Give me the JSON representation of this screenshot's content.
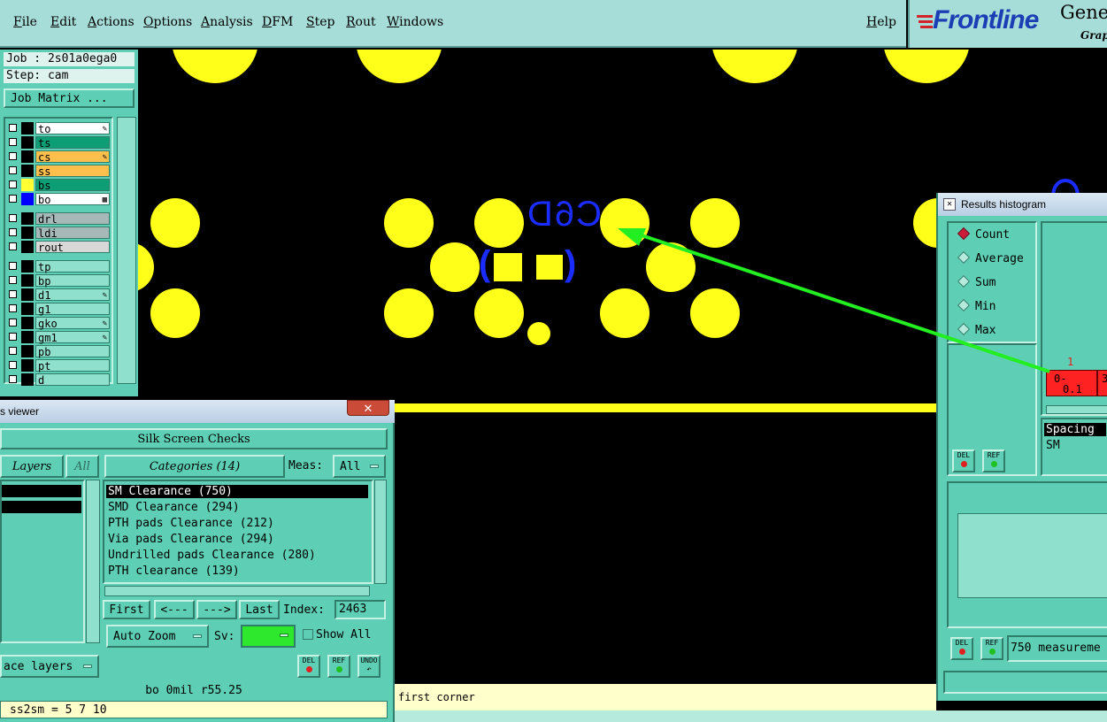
{
  "menubar": {
    "items": [
      "File",
      "Edit",
      "Actions",
      "Options",
      "Analysis",
      "DFM",
      "Step",
      "Rout",
      "Windows"
    ],
    "help": "Help"
  },
  "logo": {
    "brand": "Frontline",
    "word1": "Gene",
    "word2": "Graph"
  },
  "job": {
    "job_line": "Job : 2s01a0ega0",
    "step_line": "Step: cam",
    "matrix_button": "Job Matrix ..."
  },
  "layers": [
    {
      "name": "to",
      "color": "#ffffff",
      "swatch": "#000000",
      "mark": "✎"
    },
    {
      "name": "ts",
      "color": "#0e9e75",
      "swatch": "#000000",
      "mark": ""
    },
    {
      "name": "cs",
      "color": "#ffbf4d",
      "swatch": "#000000",
      "mark": "✎"
    },
    {
      "name": "ss",
      "color": "#ffbf4d",
      "swatch": "#000000",
      "mark": ""
    },
    {
      "name": "bs",
      "color": "#0e9e75",
      "swatch": "#ffff33",
      "mark": ""
    },
    {
      "name": "bo",
      "color": "#ffffff",
      "swatch": "#0000ff",
      "mark": "▦"
    },
    {
      "name": "drl",
      "color": "#a6b8b8",
      "swatch": "#000000",
      "mark": ""
    },
    {
      "name": "ldi",
      "color": "#a6b8b8",
      "swatch": "#000000",
      "mark": ""
    },
    {
      "name": "rout",
      "color": "#d8d8d8",
      "swatch": "#000000",
      "mark": ""
    },
    {
      "name": "tp",
      "color": "#8fe0cc",
      "swatch": "#000000",
      "mark": ""
    },
    {
      "name": "bp",
      "color": "#8fe0cc",
      "swatch": "#000000",
      "mark": ""
    },
    {
      "name": "d1",
      "color": "#8fe0cc",
      "swatch": "#000000",
      "mark": "✎"
    },
    {
      "name": "g1",
      "color": "#8fe0cc",
      "swatch": "#000000",
      "mark": ""
    },
    {
      "name": "gko",
      "color": "#8fe0cc",
      "swatch": "#000000",
      "mark": "✎"
    },
    {
      "name": "gm1",
      "color": "#8fe0cc",
      "swatch": "#000000",
      "mark": "✎"
    },
    {
      "name": "pb",
      "color": "#8fe0cc",
      "swatch": "#000000",
      "mark": ""
    },
    {
      "name": "pt",
      "color": "#8fe0cc",
      "swatch": "#000000",
      "mark": ""
    },
    {
      "name": "d",
      "color": "#8fe0cc",
      "swatch": "#000000",
      "mark": ""
    }
  ],
  "canvas": {
    "silk_label": "C6D",
    "silk_left": "(",
    "silk_right": ")"
  },
  "viewer": {
    "title": "s viewer",
    "section": "Silk Screen Checks",
    "layers_label": "Layers",
    "all_label": "All",
    "categories_label": "Categories (14)",
    "meas_label": "Meas:",
    "meas_value": "All",
    "categories": [
      "SM Clearance (750)",
      "SMD Clearance (294)",
      "PTH pads Clearance (212)",
      "Via pads Clearance (294)",
      "Undrilled pads Clearance (280)",
      "PTH clearance (139)"
    ],
    "first": "First",
    "prev": "<---",
    "next": "--->",
    "last": "Last",
    "index_label": "Index:",
    "index_value": "2463",
    "auto_zoom": "Auto Zoom",
    "sv_label": "Sv:",
    "show_all": "Show All",
    "surface_layers": "ace layers",
    "del": "DEL",
    "ref": "REF",
    "undo": "UNDO",
    "info_line": "bo 0mil  r55.25",
    "cmd_line": "ss2sm = 5 7 10"
  },
  "status": {
    "text": "first corner"
  },
  "histogram": {
    "title": "Results histogram",
    "modes": [
      "Count",
      "Average",
      "Sum",
      "Min",
      "Max"
    ],
    "selected": "Count",
    "bar_count": "1",
    "bar_label_1": "0-",
    "bar_label_2": "0.1",
    "bar_next": "3",
    "list_selected": "Spacing",
    "list_item": "SM",
    "measurements": "750 measureme",
    "del": "DEL",
    "ref": "REF"
  }
}
